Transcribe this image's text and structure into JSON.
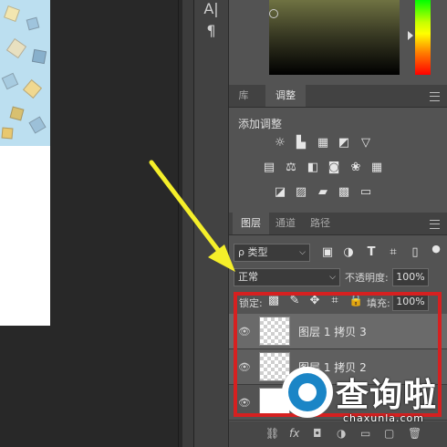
{
  "mini_panel": {
    "glyph_a": "A|",
    "glyph_pilcrow": "¶"
  },
  "adjust_tabs": {
    "tab_library": "库",
    "tab_adjust": "调整"
  },
  "adjust_panel": {
    "title": "添加调整"
  },
  "layers_tabs": {
    "tab_layers": "图层",
    "tab_channels": "通道",
    "tab_paths": "路径"
  },
  "layers_panel": {
    "filter_kind": "ρ 类型",
    "blend_mode": "正常",
    "opacity_label": "不透明度:",
    "opacity_value": "100%",
    "lock_label": "锁定:",
    "fill_label": "填充:",
    "fill_value": "100%",
    "layers": [
      {
        "name": "图层 1 拷贝 3"
      },
      {
        "name": "图层 1 拷贝 2"
      },
      {
        "name": ""
      }
    ]
  },
  "watermark": {
    "main": "查询啦",
    "sub": "chaxunla.com"
  },
  "colors": {
    "highlight": "#d62020",
    "arrow": "#f5ef2a",
    "panel": "#535353",
    "watermark_blue": "#1a85c6"
  }
}
